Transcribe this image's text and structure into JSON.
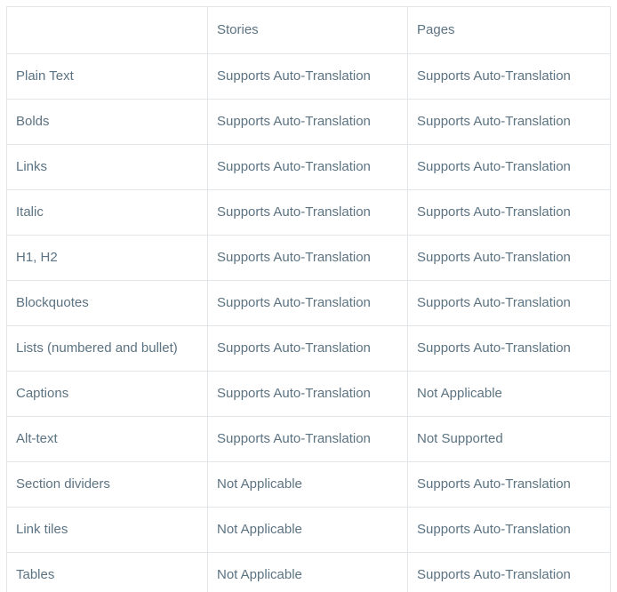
{
  "table": {
    "caption": "",
    "columns": [
      {
        "key": "feature",
        "label": ""
      },
      {
        "key": "stories",
        "label": "Stories"
      },
      {
        "key": "pages",
        "label": "Pages"
      }
    ],
    "rows": [
      {
        "feature": "Plain Text",
        "stories": "Supports Auto-Translation",
        "pages": "Supports Auto-Translation"
      },
      {
        "feature": "Bolds",
        "stories": "Supports Auto-Translation",
        "pages": "Supports Auto-Translation"
      },
      {
        "feature": "Links",
        "stories": "Supports Auto-Translation",
        "pages": "Supports Auto-Translation"
      },
      {
        "feature": "Italic",
        "stories": "Supports Auto-Translation",
        "pages": "Supports Auto-Translation"
      },
      {
        "feature": "H1, H2",
        "stories": "Supports Auto-Translation",
        "pages": "Supports Auto-Translation"
      },
      {
        "feature": "Blockquotes",
        "stories": "Supports Auto-Translation",
        "pages": "Supports Auto-Translation"
      },
      {
        "feature": "Lists (numbered and bullet)",
        "stories": "Supports Auto-Translation",
        "pages": "Supports Auto-Translation"
      },
      {
        "feature": "Captions",
        "stories": "Supports Auto-Translation",
        "pages": "Not Applicable"
      },
      {
        "feature": "Alt-text",
        "stories": "Supports Auto-Translation",
        "pages": "Not Supported"
      },
      {
        "feature": "Section dividers",
        "stories": "Not Applicable",
        "pages": "Supports Auto-Translation"
      },
      {
        "feature": "Link tiles",
        "stories": "Not Applicable",
        "pages": "Supports Auto-Translation"
      },
      {
        "feature": "Tables",
        "stories": "Not Applicable",
        "pages": "Supports Auto-Translation"
      }
    ]
  },
  "colors": {
    "text": "#5c7382",
    "border": "#e3e6e9",
    "background": "#ffffff"
  }
}
